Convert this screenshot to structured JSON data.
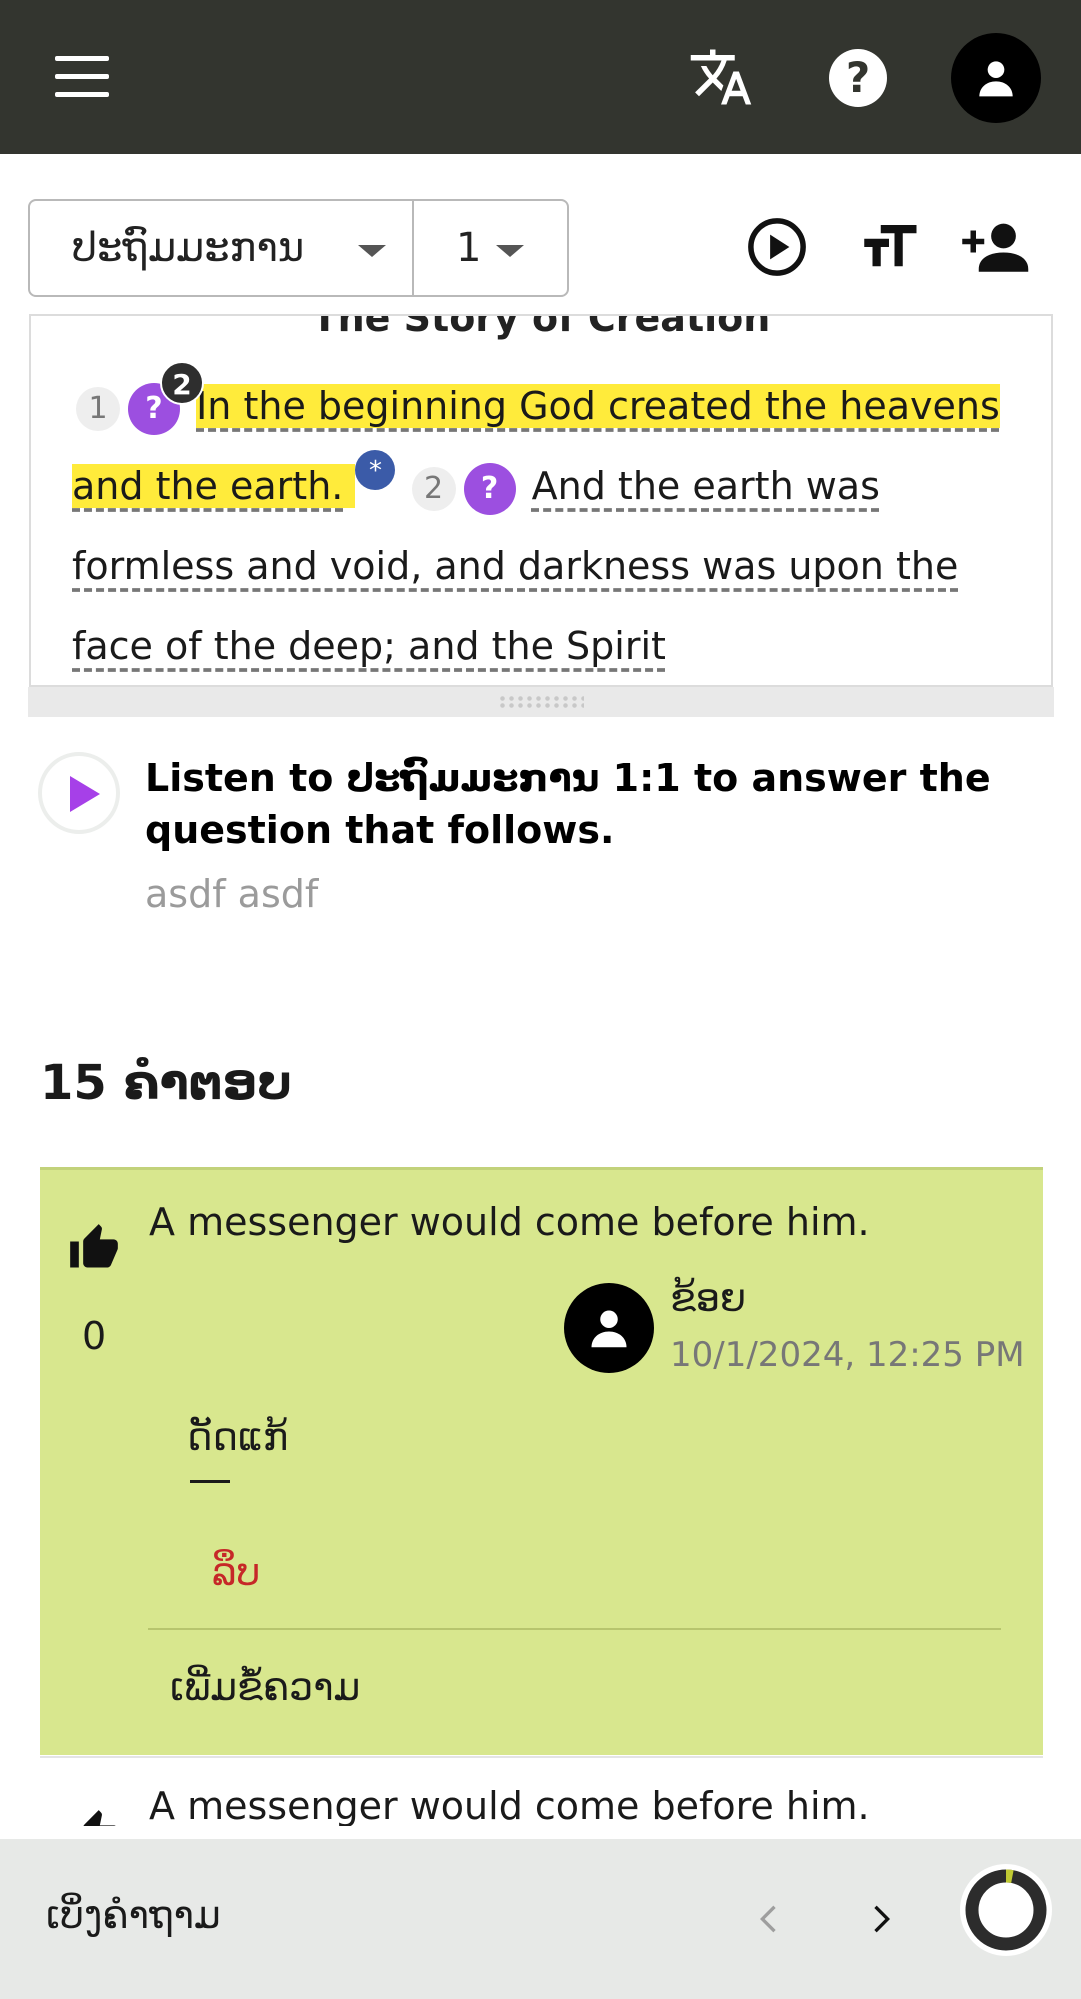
{
  "appbar": {
    "menu_icon": "menu-icon",
    "translate_icon": "translate-icon",
    "help_icon": "help-icon",
    "help_glyph": "?",
    "account_icon": "account-icon"
  },
  "toolbar": {
    "book": "ປະຖົມມະການ",
    "chapter": "1",
    "play_icon": "play-circle-icon",
    "text_size_icon": "text-size-icon",
    "add_person_icon": "add-person-icon"
  },
  "scripture": {
    "heading": "The Story of Creation",
    "verse1_number": "1",
    "verse1_question_glyph": "?",
    "verse1_question_count": "2",
    "verse1_text": "In the beginning God created the heavens and the earth.",
    "note_marker": "*",
    "verse2_number": "2",
    "verse2_question_glyph": "?",
    "verse2_text": "And the earth was formless and void, and darkness was upon the face of the deep; and the Spirit"
  },
  "prompt": {
    "title": "Listen to ປະຖົມມະການ 1:1 to answer the question that follows.",
    "subtitle": "asdf asdf"
  },
  "answers": {
    "heading": "15 ຄຳຕອບ",
    "items": [
      {
        "text": "A messenger would come before him.",
        "votes": "0",
        "author": "ຂ້ອຍ",
        "date": "10/1/2024, 12:25 PM",
        "edit_label": "ດັດແກ້",
        "separator": "—",
        "delete_label": "ລຶບ",
        "add_comment_label": "ເພີ່ມຂໍ້ຄວາມ"
      },
      {
        "text": "A messenger would come before him."
      }
    ]
  },
  "bottombar": {
    "view_question_label": "ເບິ່ງຄຳຖາມ",
    "prev_icon": "chevron-left-icon",
    "next_icon": "chevron-right-icon",
    "progress": 0.03,
    "progress_color": "#c0ca33"
  },
  "colors": {
    "appbar": "#33352f",
    "highlight": "#ffeb3b",
    "question_badge": "#9c4fe0",
    "answer_card": "#d8e78e",
    "delete": "#c62828"
  }
}
